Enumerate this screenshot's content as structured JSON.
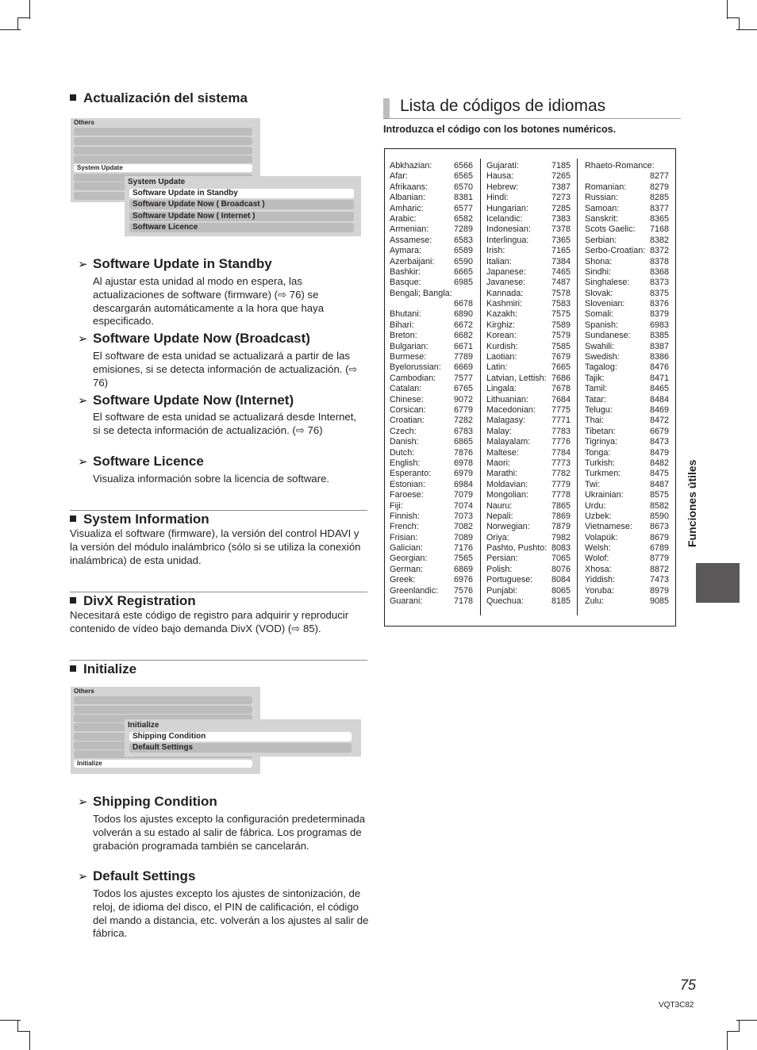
{
  "left": {
    "section_system_update": {
      "title": "Actualización del sistema",
      "menu": {
        "title": "Others",
        "selected_item": "System Update",
        "popup_title": "System Update",
        "popup_items": [
          {
            "label": "Software Update in Standby",
            "selected": true
          },
          {
            "label": "Software Update Now ( Broadcast )",
            "selected": false
          },
          {
            "label": "Software Update Now ( Internet )",
            "selected": false
          },
          {
            "label": "Software Licence",
            "selected": false
          }
        ]
      },
      "items": [
        {
          "heading": "Software Update in Standby",
          "text": "Al ajustar esta unidad al modo en espera, las actualizaciones de software (firmware) (⇨ 76) se descargarán automáticamente a la hora que haya especificado."
        },
        {
          "heading": "Software Update Now (Broadcast)",
          "text": "El software de esta unidad se actualizará a partir de las emisiones, si se detecta información de actualización. (⇨ 76)"
        },
        {
          "heading": "Software Update Now (Internet)",
          "text": "El software de esta unidad se actualizará desde Internet, si se detecta información de actualización. (⇨ 76)"
        },
        {
          "heading": "Software Licence",
          "text": "Visualiza información sobre la licencia de software."
        }
      ]
    },
    "section_system_information": {
      "title": "System Information",
      "text": "Visualiza el software (firmware), la versión del control HDAVI y la versión del módulo inalámbrico (sólo si se utiliza la conexión inalámbrica) de esta unidad."
    },
    "section_divx": {
      "title": "DivX Registration",
      "text": "Necesitará este código de registro para adquirir y reproducir contenido de vídeo bajo demanda DivX (VOD) (⇨ 85)."
    },
    "section_initialize": {
      "title": "Initialize",
      "menu": {
        "title": "Others",
        "selected_item": "Initialize",
        "popup_title": "Initialize",
        "popup_items": [
          {
            "label": "Shipping Condition",
            "selected": true
          },
          {
            "label": "Default Settings",
            "selected": false
          }
        ]
      },
      "items": [
        {
          "heading": "Shipping Condition",
          "text": "Todos los ajustes excepto la configuración predeterminada volverán a su estado al salir de fábrica. Los programas de grabación programada también se cancelarán."
        },
        {
          "heading": "Default Settings",
          "text": "Todos los ajustes excepto los ajustes de sintonización, de reloj, de idioma del disco, el PIN de calificación, el código del mando a distancia, etc. volverán a los ajustes al salir de fábrica."
        }
      ]
    }
  },
  "right": {
    "title": "Lista de códigos de idiomas",
    "intro": "Introduzca el código con los botones numéricos.",
    "columns": [
      [
        {
          "name": "Abkhazian:",
          "code": "6566"
        },
        {
          "name": "Afar:",
          "code": "6565"
        },
        {
          "name": "Afrikaans:",
          "code": "6570"
        },
        {
          "name": "Albanian:",
          "code": "8381"
        },
        {
          "name": "Amharic:",
          "code": "6577"
        },
        {
          "name": "Arabic:",
          "code": "6582"
        },
        {
          "name": "Armenian:",
          "code": "7289"
        },
        {
          "name": "Assamese:",
          "code": "6583"
        },
        {
          "name": "Aymara:",
          "code": "6589"
        },
        {
          "name": "Azerbaijani:",
          "code": "6590"
        },
        {
          "name": "Bashkir:",
          "code": "6665"
        },
        {
          "name": "Basque:",
          "code": "6985"
        },
        {
          "name": "Bengali; Bangla:",
          "code": "6678",
          "wrap": true
        },
        {
          "name": "Bhutani:",
          "code": "6890"
        },
        {
          "name": "Bihari:",
          "code": "6672"
        },
        {
          "name": "Breton:",
          "code": "6682"
        },
        {
          "name": "Bulgarian:",
          "code": "6671"
        },
        {
          "name": "Burmese:",
          "code": "7789"
        },
        {
          "name": "Byelorussian:",
          "code": "6669"
        },
        {
          "name": "Cambodian:",
          "code": "7577"
        },
        {
          "name": "Catalan:",
          "code": "6765"
        },
        {
          "name": "Chinese:",
          "code": "9072"
        },
        {
          "name": "Corsican:",
          "code": "6779"
        },
        {
          "name": "Croatian:",
          "code": "7282"
        },
        {
          "name": "Czech:",
          "code": "6783"
        },
        {
          "name": "Danish:",
          "code": "6865"
        },
        {
          "name": "Dutch:",
          "code": "7876"
        },
        {
          "name": "English:",
          "code": "6978"
        },
        {
          "name": "Esperanto:",
          "code": "6979"
        },
        {
          "name": "Estonian:",
          "code": "6984"
        },
        {
          "name": "Faroese:",
          "code": "7079"
        },
        {
          "name": "Fiji:",
          "code": "7074"
        },
        {
          "name": "Finnish:",
          "code": "7073"
        },
        {
          "name": "French:",
          "code": "7082"
        },
        {
          "name": "Frisian:",
          "code": "7089"
        },
        {
          "name": "Galician:",
          "code": "7176"
        },
        {
          "name": "Georgian:",
          "code": "7565"
        },
        {
          "name": "German:",
          "code": "6869"
        },
        {
          "name": "Greek:",
          "code": "6976"
        },
        {
          "name": "Greenlandic:",
          "code": "7576"
        },
        {
          "name": "Guarani:",
          "code": "7178"
        }
      ],
      [
        {
          "name": "Gujarati:",
          "code": "7185"
        },
        {
          "name": "Hausa:",
          "code": "7265"
        },
        {
          "name": "Hebrew:",
          "code": "7387"
        },
        {
          "name": "Hindi:",
          "code": "7273"
        },
        {
          "name": "Hungarian:",
          "code": "7285"
        },
        {
          "name": "Icelandic:",
          "code": "7383"
        },
        {
          "name": "Indonesian:",
          "code": "7378"
        },
        {
          "name": "Interlingua:",
          "code": "7365"
        },
        {
          "name": "Irish:",
          "code": "7165"
        },
        {
          "name": "Italian:",
          "code": "7384"
        },
        {
          "name": "Japanese:",
          "code": "7465"
        },
        {
          "name": "Javanese:",
          "code": "7487"
        },
        {
          "name": "Kannada:",
          "code": "7578"
        },
        {
          "name": "Kashmiri:",
          "code": "7583"
        },
        {
          "name": "Kazakh:",
          "code": "7575"
        },
        {
          "name": "Kirghiz:",
          "code": "7589"
        },
        {
          "name": "Korean:",
          "code": "7579"
        },
        {
          "name": "Kurdish:",
          "code": "7585"
        },
        {
          "name": "Laotian:",
          "code": "7679"
        },
        {
          "name": "Latin:",
          "code": "7665"
        },
        {
          "name": "Latvian, Lettish:",
          "code": "7686"
        },
        {
          "name": "Lingala:",
          "code": "7678"
        },
        {
          "name": "Lithuanian:",
          "code": "7684"
        },
        {
          "name": "Macedonian:",
          "code": "7775"
        },
        {
          "name": "Malagasy:",
          "code": "7771"
        },
        {
          "name": "Malay:",
          "code": "7783"
        },
        {
          "name": "Malayalam:",
          "code": "7776"
        },
        {
          "name": "Maltese:",
          "code": "7784"
        },
        {
          "name": "Maori:",
          "code": "7773"
        },
        {
          "name": "Marathi:",
          "code": "7782"
        },
        {
          "name": "Moldavian:",
          "code": "7779"
        },
        {
          "name": "Mongolian:",
          "code": "7778"
        },
        {
          "name": "Nauru:",
          "code": "7865"
        },
        {
          "name": "Nepali:",
          "code": "7869"
        },
        {
          "name": "Norwegian:",
          "code": "7879"
        },
        {
          "name": "Oriya:",
          "code": "7982"
        },
        {
          "name": "Pashto, Pushto:",
          "code": "8083"
        },
        {
          "name": "Persian:",
          "code": "7065"
        },
        {
          "name": "Polish:",
          "code": "8076"
        },
        {
          "name": "Portuguese:",
          "code": "8084"
        },
        {
          "name": "Punjabi:",
          "code": "8065"
        },
        {
          "name": "Quechua:",
          "code": "8185"
        }
      ],
      [
        {
          "name": "Rhaeto-Romance:",
          "code": "8277",
          "wrap": true
        },
        {
          "name": "Romanian:",
          "code": "8279"
        },
        {
          "name": "Russian:",
          "code": "8285"
        },
        {
          "name": "Samoan:",
          "code": "8377"
        },
        {
          "name": "Sanskrit:",
          "code": "8365"
        },
        {
          "name": "Scots Gaelic:",
          "code": "7168"
        },
        {
          "name": "Serbian:",
          "code": "8382"
        },
        {
          "name": "Serbo-Croatian:",
          "code": "8372"
        },
        {
          "name": "Shona:",
          "code": "8378"
        },
        {
          "name": "Sindhi:",
          "code": "8368"
        },
        {
          "name": "Singhalese:",
          "code": "8373"
        },
        {
          "name": "Slovak:",
          "code": "8375"
        },
        {
          "name": "Slovenian:",
          "code": "8376"
        },
        {
          "name": "Somali:",
          "code": "8379"
        },
        {
          "name": "Spanish:",
          "code": "6983"
        },
        {
          "name": "Sundanese:",
          "code": "8385"
        },
        {
          "name": "Swahili:",
          "code": "8387"
        },
        {
          "name": "Swedish:",
          "code": "8386"
        },
        {
          "name": "Tagalog:",
          "code": "8476"
        },
        {
          "name": "Tajik:",
          "code": "8471"
        },
        {
          "name": "Tamil:",
          "code": "8465"
        },
        {
          "name": "Tatar:",
          "code": "8484"
        },
        {
          "name": "Telugu:",
          "code": "8469"
        },
        {
          "name": "Thai:",
          "code": "8472"
        },
        {
          "name": "Tibetan:",
          "code": "6679"
        },
        {
          "name": "Tigrinya:",
          "code": "8473"
        },
        {
          "name": "Tonga:",
          "code": "8479"
        },
        {
          "name": "Turkish:",
          "code": "8482"
        },
        {
          "name": "Turkmen:",
          "code": "8475"
        },
        {
          "name": "Twi:",
          "code": "8487"
        },
        {
          "name": "Ukrainian:",
          "code": "8575"
        },
        {
          "name": "Urdu:",
          "code": "8582"
        },
        {
          "name": "Uzbek:",
          "code": "8590"
        },
        {
          "name": "Vietnamese:",
          "code": "8673"
        },
        {
          "name": "Volapük:",
          "code": "8679"
        },
        {
          "name": "Welsh:",
          "code": "6789"
        },
        {
          "name": "Wolof:",
          "code": "8779"
        },
        {
          "name": "Xhosa:",
          "code": "8872"
        },
        {
          "name": "Yiddish:",
          "code": "7473"
        },
        {
          "name": "Yoruba:",
          "code": "8979"
        },
        {
          "name": "Zulu:",
          "code": "9085"
        }
      ]
    ]
  },
  "side_tab": {
    "label": "Funciones útiles",
    "color": "#5a5859"
  },
  "footer": {
    "page_number": "75",
    "doc_code": "VQT3C82"
  },
  "glyphs": {
    "arrow": "➢",
    "bullet": "■"
  }
}
